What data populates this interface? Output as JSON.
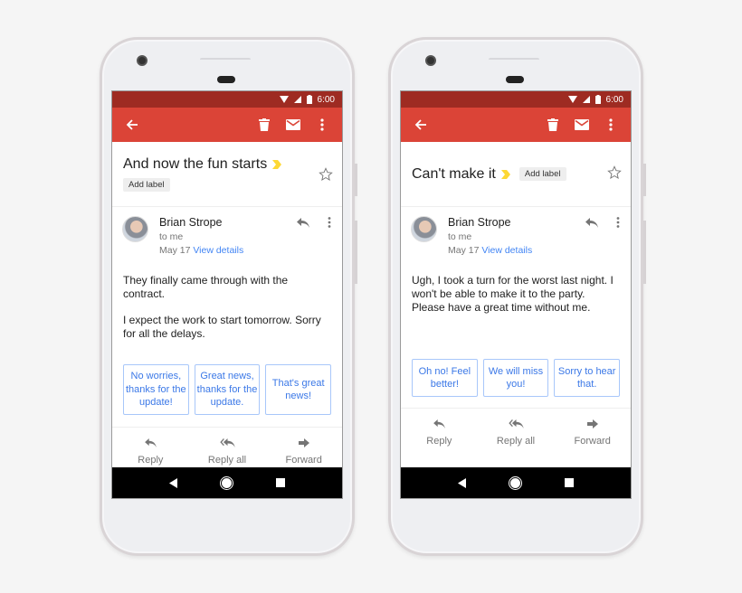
{
  "phones": [
    {
      "status": {
        "time": "6:00"
      },
      "subject": "And now the fun starts",
      "label_chip": "Add label",
      "sender": {
        "name": "Brian Strope",
        "to": "to me",
        "date": "May 17",
        "view_details": "View details"
      },
      "body": [
        "They finally came through with the contract.",
        "I expect the work to start tomorrow. Sorry for all the delays."
      ],
      "smart_replies": [
        "No worries, thanks for the update!",
        "Great news, thanks for the update.",
        "That's great news!"
      ],
      "actions": {
        "reply": "Reply",
        "reply_all": "Reply all",
        "forward": "Forward"
      }
    },
    {
      "status": {
        "time": "6:00"
      },
      "subject": "Can't make it",
      "label_chip": "Add label",
      "sender": {
        "name": "Brian Strope",
        "to": "to me",
        "date": "May 17",
        "view_details": "View details"
      },
      "body": [
        "Ugh, I took a turn for the worst last night. I won't be able to make it to the party. Please have a great time without me."
      ],
      "smart_replies": [
        "Oh no! Feel better!",
        "We will miss you!",
        "Sorry to hear that."
      ],
      "actions": {
        "reply": "Reply",
        "reply_all": "Reply all",
        "forward": "Forward"
      }
    }
  ],
  "icons": {
    "appbar": [
      "back-arrow-icon",
      "delete-icon",
      "mark-unread-icon",
      "more-vert-icon"
    ],
    "status": [
      "wifi-icon",
      "signal-icon",
      "battery-icon"
    ],
    "nav": [
      "back-triangle-icon",
      "home-circle-icon",
      "recents-square-icon"
    ]
  },
  "colors": {
    "appbar": "#db4437",
    "statusbar": "#9e2b22",
    "link": "#4285f4",
    "smart_reply_text": "#3b78e7",
    "importance": "#fdd835"
  }
}
